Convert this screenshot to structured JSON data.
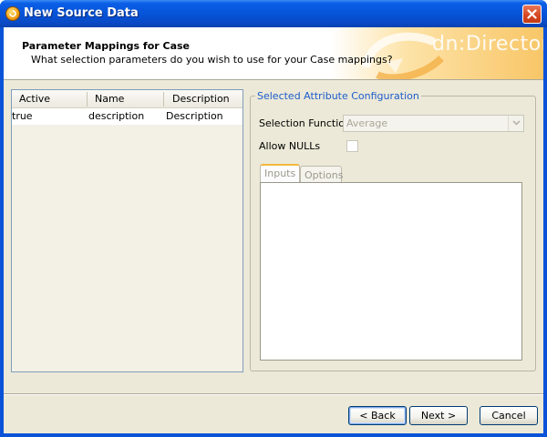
{
  "window": {
    "title": "New Source Data"
  },
  "header": {
    "title": "Parameter Mappings for Case",
    "subtitle": "What selection parameters do you wish to use for your Case mappings?",
    "brand": "dn:Director"
  },
  "table": {
    "columns": [
      "Active",
      "Name",
      "Description"
    ],
    "rows": [
      {
        "active": "true",
        "name": "description",
        "description": "Description"
      }
    ]
  },
  "config": {
    "legend": "Selected Attribute Configuration",
    "selection_function_label": "Selection Function",
    "selection_function_value": "Average",
    "allow_nulls_label": "Allow NULLs",
    "allow_nulls_checked": false,
    "tabs": [
      "Inputs",
      "Options"
    ],
    "active_tab": "Inputs"
  },
  "buttons": {
    "back": "< Back",
    "next": "Next >",
    "cancel": "Cancel"
  },
  "colors": {
    "title_bar": "#0552d6",
    "dialog_bg": "#ece9d8",
    "legend_text": "#1d5bcc",
    "header_accent": "#f8c667"
  },
  "icons": {
    "window": "app-icon",
    "close": "close-icon",
    "dropdown": "chevron-down-icon",
    "brand": "dn-director-logo"
  }
}
